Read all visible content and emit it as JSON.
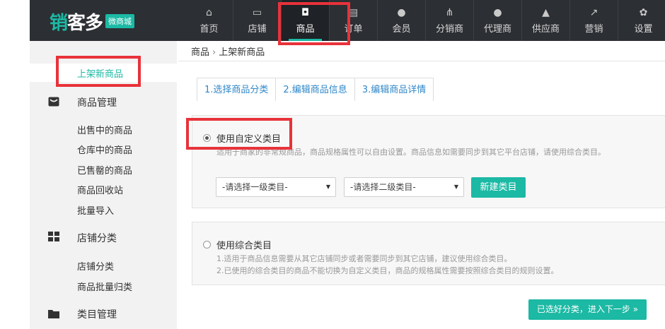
{
  "logo": {
    "brand_a": "销",
    "brand_b": "客多",
    "badge": "微商城"
  },
  "nav": [
    {
      "label": "首页",
      "icon": "home-icon",
      "glyph": "⌂"
    },
    {
      "label": "店铺",
      "icon": "store-icon",
      "glyph": "▭"
    },
    {
      "label": "商品",
      "icon": "shopping-bag-icon",
      "glyph": "◘"
    },
    {
      "label": "订单",
      "icon": "order-icon",
      "glyph": "▤"
    },
    {
      "label": "会员",
      "icon": "member-icon",
      "glyph": "●"
    },
    {
      "label": "分销商",
      "icon": "distributor-icon",
      "glyph": "⋔"
    },
    {
      "label": "代理商",
      "icon": "agent-icon",
      "glyph": "●"
    },
    {
      "label": "供应商",
      "icon": "supplier-icon",
      "glyph": "▲"
    },
    {
      "label": "营销",
      "icon": "marketing-icon",
      "glyph": "↗"
    },
    {
      "label": "设置",
      "icon": "settings-icon",
      "glyph": "✿"
    }
  ],
  "sidebar": {
    "active": "上架新商品",
    "goods_mgmt": "商品管理",
    "goods_items": [
      "出售中的商品",
      "仓库中的商品",
      "已售罄的商品",
      "商品回收站",
      "批量导入"
    ],
    "store_cat": "店铺分类",
    "store_items": [
      "店铺分类",
      "商品批量归类"
    ],
    "cat_mgmt": "类目管理"
  },
  "breadcrumb": {
    "root": "商品",
    "sep": "›",
    "current": "上架新商品"
  },
  "steps": [
    "1.选择商品分类",
    "2.编辑商品信息",
    "3.编辑商品详情"
  ],
  "option_custom": {
    "title": "使用自定义类目",
    "desc": "适用于商家的非常规商品，商品规格属性可以自由设置。商品信息如需要同步到其它平台店铺，请使用综合类目。",
    "select1": "-请选择一级类目-",
    "select2": "-请选择二级类目-",
    "new_button": "新建类目"
  },
  "option_general": {
    "title": "使用综合类目",
    "desc1": "1.适用于商品信息需要从其它店铺同步或者需要同步到其它店铺，建议使用综合类目。",
    "desc2": "2.已使用的综合类目的商品不能切换为自定义类目，商品的规格属性需要按照综合类目的规则设置。"
  },
  "next_button": "已选好分类，进入下一步 »",
  "colors": {
    "accent": "#1cb9a4",
    "topbar": "#2c2f33",
    "link": "#2f87c8",
    "highlight": "#e8323a"
  }
}
